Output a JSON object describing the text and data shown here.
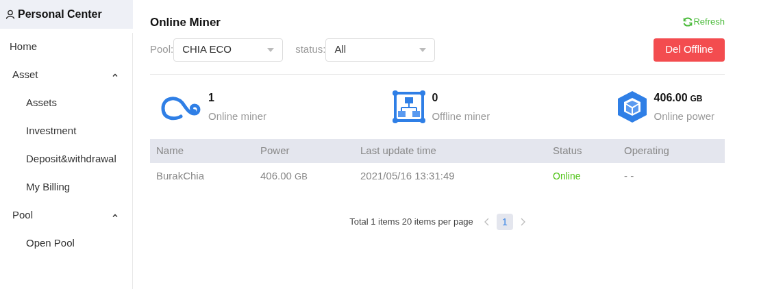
{
  "sidebar": {
    "header": "Personal Center",
    "items": [
      {
        "label": "Home"
      },
      {
        "label": "Asset",
        "expanded": true,
        "children": [
          {
            "label": "Assets"
          },
          {
            "label": "Investment"
          },
          {
            "label": "Deposit&withdrawal"
          },
          {
            "label": "My Billing"
          }
        ]
      },
      {
        "label": "Pool",
        "expanded": true,
        "children": [
          {
            "label": "Open Pool"
          }
        ]
      }
    ]
  },
  "page": {
    "title": "Online Miner",
    "refresh": "Refresh",
    "filters": [
      {
        "label": "Pool:",
        "value": "CHIA ECO"
      },
      {
        "label": "status:",
        "value": "All"
      }
    ],
    "del_button": "Del Offline"
  },
  "stats": [
    {
      "kind": "online",
      "value": "1",
      "label": "Online miner"
    },
    {
      "kind": "offline",
      "value": "0",
      "label": "Offline miner"
    },
    {
      "kind": "power",
      "value": "406.00",
      "unit": "GB",
      "label": "Online power"
    }
  ],
  "table": {
    "columns": [
      "Name",
      "Power",
      "Last update time",
      "Status",
      "Operating"
    ],
    "rows": [
      {
        "name": "BurakChia",
        "power": "406.00",
        "unit": "GB",
        "time": "2021/05/16 13:31:49",
        "status": "Online",
        "operating": "- -"
      }
    ]
  },
  "pagination": {
    "summary": "Total 1 items 20 items per page",
    "pages": [
      {
        "label": "1",
        "selected": true
      }
    ]
  }
}
